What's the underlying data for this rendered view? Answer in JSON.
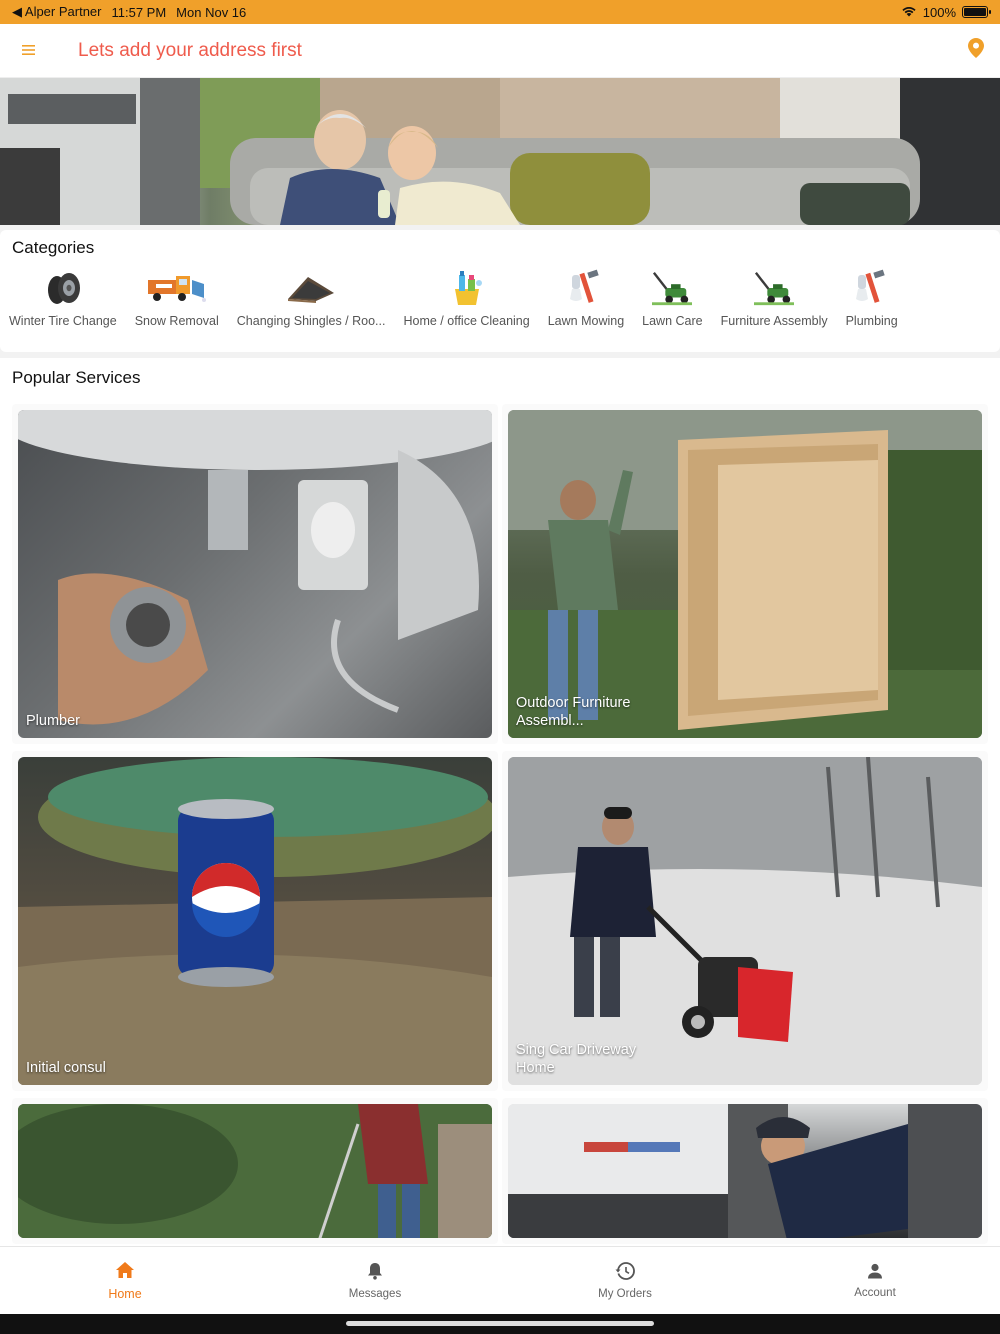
{
  "status_bar": {
    "back_app": "◀ Alper Partner",
    "time": "11:57 PM",
    "date": "Mon Nov 16",
    "battery_text": "100%",
    "battery_level": 1.0
  },
  "header": {
    "title": "Lets add your address first",
    "menu_icon": "hamburger-menu-icon",
    "location_icon": "map-pin-icon"
  },
  "categories": {
    "title": "Categories",
    "items": [
      {
        "label": "Winter Tire Change",
        "icon": "tire-icon"
      },
      {
        "label": "Snow Removal",
        "icon": "snow-plow-truck-icon"
      },
      {
        "label": "Changing Shingles / Roo...",
        "icon": "roof-icon"
      },
      {
        "label": "Home / office Cleaning",
        "icon": "cleaning-supplies-icon"
      },
      {
        "label": "Lawn Mowing",
        "icon": "pipe-wrench-icon"
      },
      {
        "label": "Lawn Care",
        "icon": "lawn-mower-icon"
      },
      {
        "label": "Furniture Assembly",
        "icon": "lawn-mower-icon"
      },
      {
        "label": "Plumbing",
        "icon": "pipe-wrench-icon"
      }
    ]
  },
  "popular": {
    "title": "Popular Services",
    "services": [
      {
        "label": "Plumber"
      },
      {
        "label": "Outdoor Furniture Assembl..."
      },
      {
        "label": "Initial consul"
      },
      {
        "label": "Sing Car Driveway Home"
      },
      {
        "label": ""
      },
      {
        "label": ""
      }
    ]
  },
  "bottom_nav": {
    "items": [
      {
        "label": "Home",
        "icon": "home-icon",
        "active": true
      },
      {
        "label": "Messages",
        "icon": "bell-icon",
        "active": false
      },
      {
        "label": "My Orders",
        "icon": "history-icon",
        "active": false
      },
      {
        "label": "Account",
        "icon": "person-icon",
        "active": false
      }
    ]
  },
  "colors": {
    "status_bar": "#f0a02a",
    "header_title": "#ef5b4c",
    "accent": "#f07a1a"
  }
}
